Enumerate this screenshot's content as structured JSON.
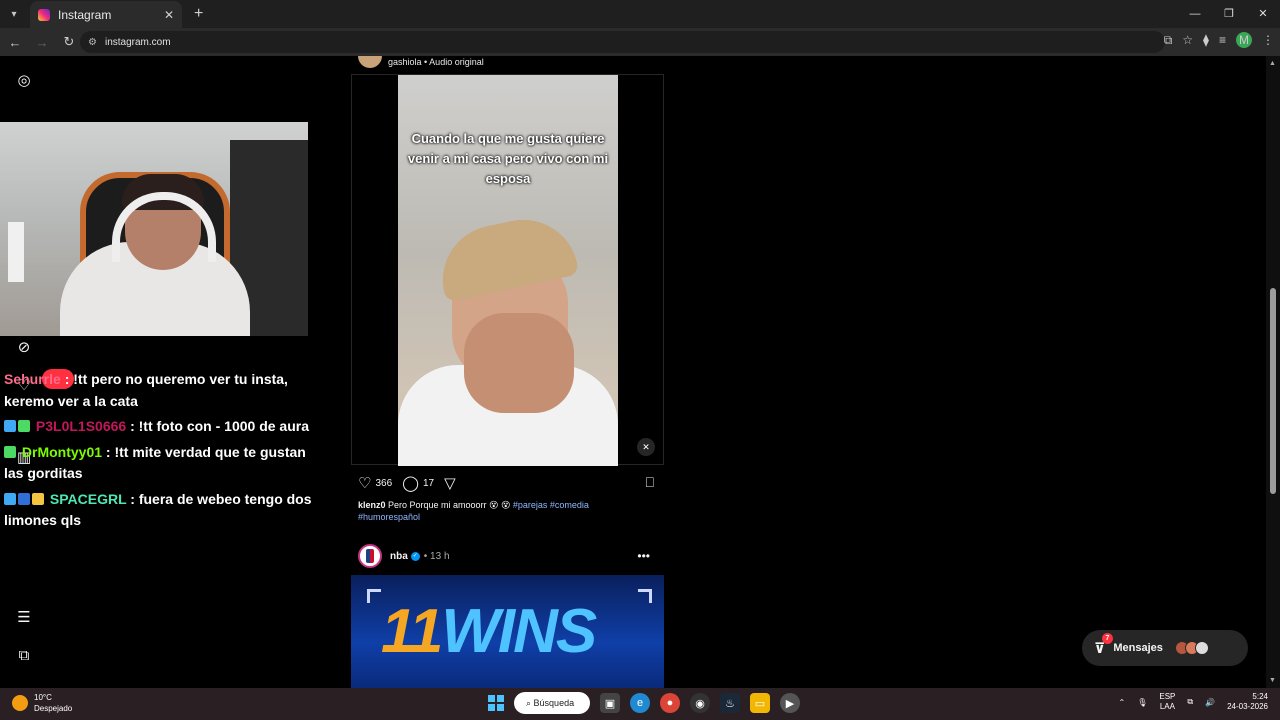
{
  "browser": {
    "tab_title": "Instagram",
    "url": "instagram.com",
    "profile_initial": "M",
    "window_controls": [
      "—",
      "❐",
      "✕"
    ]
  },
  "feed": {
    "post1": {
      "author_meta": "gashiola • Audio original",
      "video_caption": "Cuando la que me gusta quiere venir a mi casa pero vivo con mi esposa",
      "likes": "366",
      "comments": "17",
      "caption_user": "klenz0",
      "caption_text": " Pero Porque mi amooorr 😵 😵 ",
      "hashtags": "#parejas #comedia #humorespañol"
    },
    "post2": {
      "author": "nba",
      "time": "• 13 h",
      "image_text_number": "11",
      "image_text_word": "WINS"
    }
  },
  "chat": [
    {
      "user": "Sehurrle",
      "user_color": "#ff6b8a",
      "text": " : !tt pero no queremo ver tu insta, keremo ver a la cata"
    },
    {
      "user": "P3L0L1S0666",
      "user_color": "#c2185b",
      "text": " : !tt foto con - 1000 de aura"
    },
    {
      "user": "DrMontyy01",
      "user_color": "#7CFC00",
      "text": " : !tt mite verdad que te gustan las gorditas"
    },
    {
      "user": "SPACEGRL",
      "user_color": "#4ee6b5",
      "text": " : fuera de webeo tengo dos limones qls"
    }
  ],
  "messages": {
    "label": "Mensajes",
    "count": "7"
  },
  "taskbar": {
    "temperature": "10°C",
    "weather": "Despejado",
    "search": "Búsqueda",
    "lang_top": "ESP",
    "lang_bottom": "LAA",
    "time": "5:24",
    "date": "24-03-2026"
  }
}
